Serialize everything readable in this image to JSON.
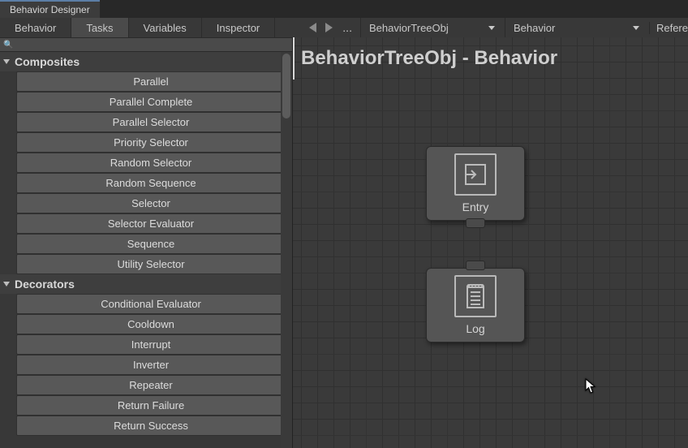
{
  "window": {
    "title": "Behavior Designer"
  },
  "tabs": {
    "items": [
      {
        "label": "Behavior"
      },
      {
        "label": "Tasks"
      },
      {
        "label": "Variables"
      },
      {
        "label": "Inspector"
      }
    ],
    "active_index": 1
  },
  "toolbar": {
    "ellipsis": "...",
    "tree_dropdown": "BehaviorTreeObj",
    "behavior_dropdown": "Behavior",
    "refs_label": "Refere"
  },
  "search": {
    "placeholder": ""
  },
  "sidebar": {
    "categories": [
      {
        "label": "Composites",
        "items": [
          "Parallel",
          "Parallel Complete",
          "Parallel Selector",
          "Priority Selector",
          "Random Selector",
          "Random Sequence",
          "Selector",
          "Selector Evaluator",
          "Sequence",
          "Utility Selector"
        ]
      },
      {
        "label": "Decorators",
        "items": [
          "Conditional Evaluator",
          "Cooldown",
          "Interrupt",
          "Inverter",
          "Repeater",
          "Return Failure",
          "Return Success"
        ]
      }
    ]
  },
  "canvas": {
    "title": "BehaviorTreeObj - Behavior",
    "nodes": {
      "entry": {
        "label": "Entry"
      },
      "log": {
        "label": "Log"
      }
    }
  }
}
